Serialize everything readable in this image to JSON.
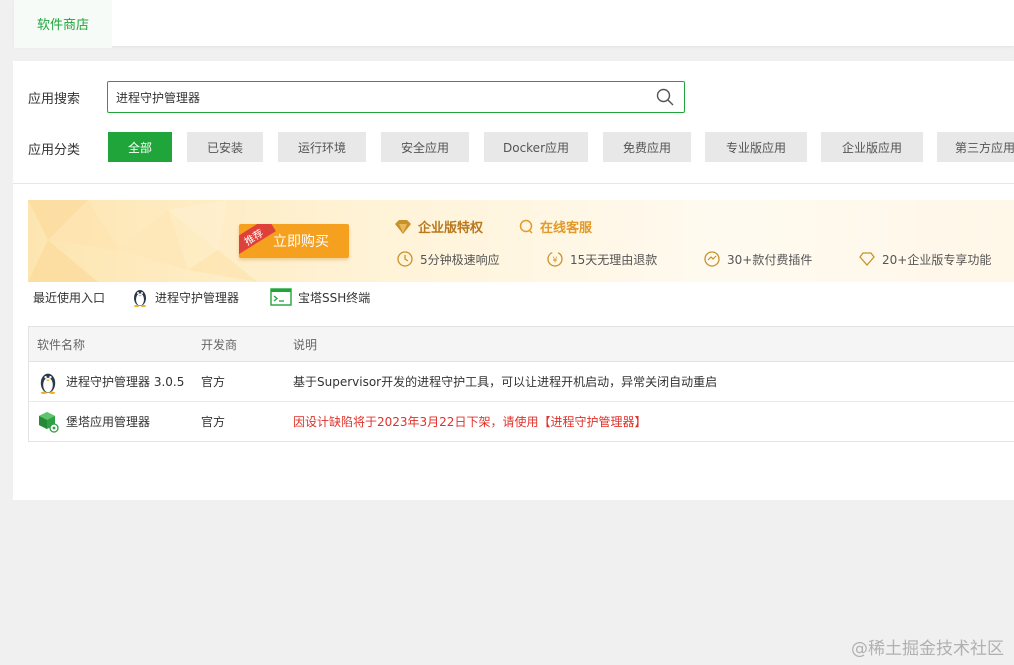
{
  "topbar": {
    "tab_label": "软件商店"
  },
  "search": {
    "label": "应用搜索",
    "value": "进程守护管理器"
  },
  "categories": {
    "label": "应用分类",
    "items": [
      "全部",
      "已安装",
      "运行环境",
      "安全应用",
      "Docker应用",
      "免费应用",
      "专业版应用",
      "企业版应用",
      "第三方应用"
    ],
    "active": "全部"
  },
  "banner": {
    "ribbon": "推荐",
    "buy_label": "立即购买",
    "enterprise_title": "企业版特权",
    "service_title": "在线客服",
    "features": [
      "5分钟极速响应",
      "15天无理由退款",
      "30+款付费插件",
      "20+企业版专享功能"
    ]
  },
  "recent": {
    "label": "最近使用入口",
    "items": [
      "进程守护管理器",
      "宝塔SSH终端"
    ]
  },
  "table": {
    "headers": [
      "软件名称",
      "开发商",
      "说明"
    ],
    "rows": [
      {
        "name": "进程守护管理器 3.0.5",
        "vendor": "官方",
        "desc": "基于Supervisor开发的进程守护工具，可以让进程开机启动，异常关闭自动重启",
        "icon": "penguin-icon"
      },
      {
        "name": "堡塔应用管理器",
        "vendor": "官方",
        "desc": "因设计缺陷将于2023年3月22日下架，请使用【进程守护管理器】",
        "icon": "app-cube-icon"
      }
    ]
  },
  "watermark": "@稀土掘金技术社区",
  "colors": {
    "accent": "#20a53a",
    "warning": "#e0312a",
    "gold": "#b8791c",
    "buy": "#f6a020"
  }
}
